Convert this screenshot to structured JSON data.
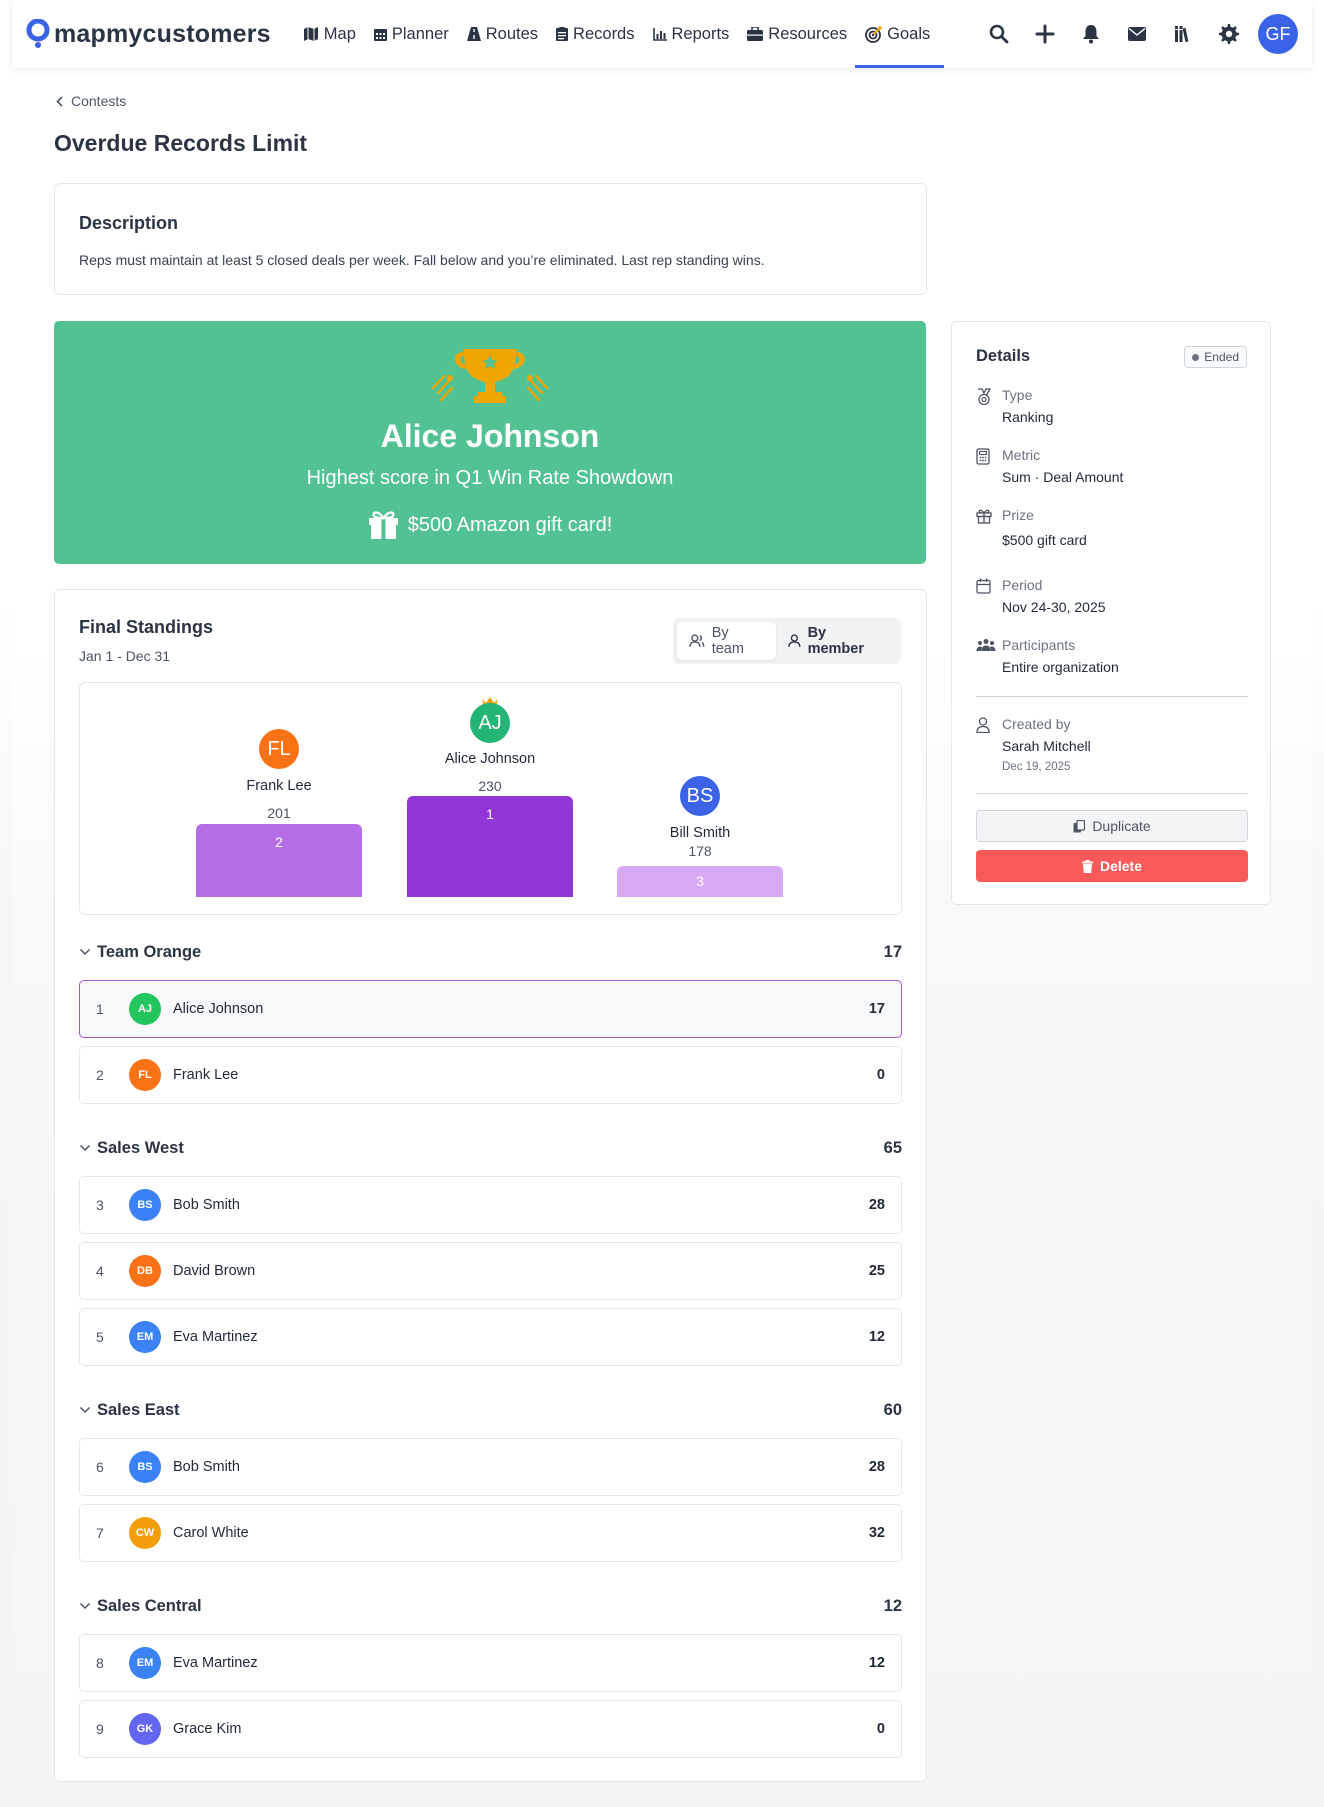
{
  "app": {
    "logo_text": "mapmycustomers",
    "user_initials": "GF"
  },
  "nav": {
    "items": [
      {
        "label": "Map",
        "icon": "map-icon"
      },
      {
        "label": "Planner",
        "icon": "calendar-icon"
      },
      {
        "label": "Routes",
        "icon": "road-icon"
      },
      {
        "label": "Records",
        "icon": "records-icon"
      },
      {
        "label": "Reports",
        "icon": "chart-icon"
      },
      {
        "label": "Resources",
        "icon": "briefcase-icon"
      },
      {
        "label": "Goals",
        "icon": "target-icon",
        "active": true
      }
    ],
    "actions": [
      "search-icon",
      "plus-icon",
      "bell-icon",
      "mail-icon",
      "library-icon",
      "gear-icon"
    ]
  },
  "breadcrumb": {
    "label": "Contests"
  },
  "page": {
    "title": "Overdue Records Limit"
  },
  "description": {
    "title": "Description",
    "text": "Reps must maintain at least 5 closed deals per week. Fall below and you’re eliminated. Last rep standing wins."
  },
  "winner": {
    "name": "Alice Johnson",
    "subtitle": "Highest score in Q1 Win Rate Showdown",
    "prize": "$500 Amazon gift card!",
    "colors": {
      "banner": "#52c293",
      "trophy": "#f0a500"
    }
  },
  "standings": {
    "title": "Final Standings",
    "range": "Jan 1 - Dec 31",
    "toggle": {
      "by_team": "By team",
      "by_member": "By member"
    },
    "podium": [
      {
        "place": "1",
        "initials": "AJ",
        "name": "Alice Johnson",
        "score": "230",
        "color": "#22b573",
        "bar": "#9036d6"
      },
      {
        "place": "2",
        "initials": "FL",
        "name": "Frank Lee",
        "score": "201",
        "color": "#f97316",
        "bar": "#b46ee6"
      },
      {
        "place": "3",
        "initials": "BS",
        "name": "Bill Smith",
        "score": "178",
        "color": "#3b63e8",
        "bar": "#d6a9f2"
      }
    ],
    "groups": [
      {
        "name": "Team Orange",
        "score": "17",
        "members": [
          {
            "rank": "1",
            "initials": "AJ",
            "name": "Alice Johnson",
            "score": "17",
            "color": "#22c55e",
            "highlight": true
          },
          {
            "rank": "2",
            "initials": "FL",
            "name": "Frank Lee",
            "score": "0",
            "color": "#f97316"
          }
        ]
      },
      {
        "name": "Sales West",
        "score": "65",
        "members": [
          {
            "rank": "3",
            "initials": "BS",
            "name": "Bob Smith",
            "score": "28",
            "color": "#3b82f6"
          },
          {
            "rank": "4",
            "initials": "DB",
            "name": "David Brown",
            "score": "25",
            "color": "#f97316"
          },
          {
            "rank": "5",
            "initials": "EM",
            "name": "Eva Martinez",
            "score": "12",
            "color": "#3b82f6"
          }
        ]
      },
      {
        "name": "Sales East",
        "score": "60",
        "members": [
          {
            "rank": "6",
            "initials": "BS",
            "name": "Bob Smith",
            "score": "28",
            "color": "#3b82f6"
          },
          {
            "rank": "7",
            "initials": "CW",
            "name": "Carol White",
            "score": "32",
            "color": "#f59e0b"
          }
        ]
      },
      {
        "name": "Sales Central",
        "score": "12",
        "members": [
          {
            "rank": "8",
            "initials": "EM",
            "name": "Eva Martinez",
            "score": "12",
            "color": "#3b82f6"
          },
          {
            "rank": "9",
            "initials": "GK",
            "name": "Grace Kim",
            "score": "0",
            "color": "#6366f1"
          }
        ]
      }
    ]
  },
  "details": {
    "title": "Details",
    "status": "Ended",
    "type": {
      "label": "Type",
      "value": "Ranking"
    },
    "metric": {
      "label": "Metric",
      "value": "Sum · Deal Amount"
    },
    "prize": {
      "label": "Prize",
      "value": "$500 gift card"
    },
    "period": {
      "label": "Period",
      "value": "Nov 24-30, 2025"
    },
    "participants": {
      "label": "Participants",
      "value": "Entire organization"
    },
    "created": {
      "label": "Created by",
      "value": "Sarah Mitchell",
      "date": "Dec 19, 2025"
    },
    "duplicate_label": "Duplicate",
    "delete_label": "Delete"
  }
}
